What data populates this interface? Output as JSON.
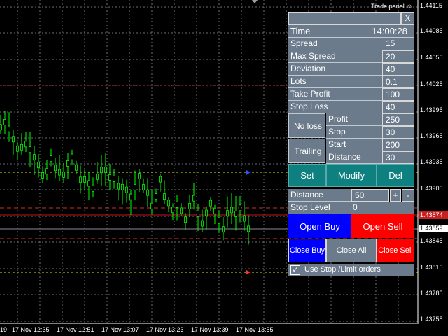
{
  "panel": {
    "title": "Trade panel",
    "close_label": "X",
    "time_label": "Time",
    "time_value": "14:00:28",
    "spread_label": "Spread",
    "spread_value": "15",
    "max_spread_label": "Max Spread",
    "max_spread_value": "20",
    "deviation_label": "Deviation",
    "deviation_value": "40",
    "lots_label": "Lots",
    "lots_value": "0.1",
    "take_profit_label": "Take Profit",
    "take_profit_value": "100",
    "stop_loss_label": "Stop Loss",
    "stop_loss_value": "40",
    "no_loss_label": "No loss",
    "no_loss_profit_label": "Profit",
    "no_loss_profit_value": "250",
    "no_loss_stop_label": "Stop",
    "no_loss_stop_value": "30",
    "trailing_label": "Trailing",
    "trailing_start_label": "Start",
    "trailing_start_value": "200",
    "trailing_distance_label": "Distance",
    "trailing_distance_value": "30",
    "set_label": "Set",
    "modify_label": "Modify",
    "del_label": "Del",
    "distance_label": "Distance",
    "distance_value": "50",
    "plus_label": "+",
    "minus_label": "-",
    "stop_level_label": "Stop Level",
    "stop_level_value": "0",
    "open_buy_label": "Open Buy",
    "open_sell_label": "Open Sell",
    "close_buy_label": "Close Buy",
    "close_all_label": "Close All",
    "close_sell_label": "Close Sell",
    "stop_limit_label": "Use Stop /Limit orders",
    "stop_limit_checked": true
  },
  "axis": {
    "prices": [
      "1.44115",
      "1.44085",
      "1.44055",
      "1.44025",
      "1.43995",
      "1.43965",
      "1.43935",
      "1.43905",
      "1.43874",
      "1.43859",
      "1.43845",
      "1.43815",
      "1.43785",
      "1.43755"
    ],
    "ask_tag": "1.43874",
    "bid_tag": "1.43859",
    "times": [
      "19",
      "17 Nov 12:35",
      "17 Nov 12:51",
      "17 Nov 13:07",
      "17 Nov 13:23",
      "17 Nov 13:39",
      "17 Nov 13:55"
    ]
  },
  "colors": {
    "candle": "#00ff00",
    "grid": "#6e6e6e",
    "panel_bg": "#6c7b8b",
    "teal": "#0f8080",
    "buy": "#0000ff",
    "sell": "#ff0000"
  }
}
